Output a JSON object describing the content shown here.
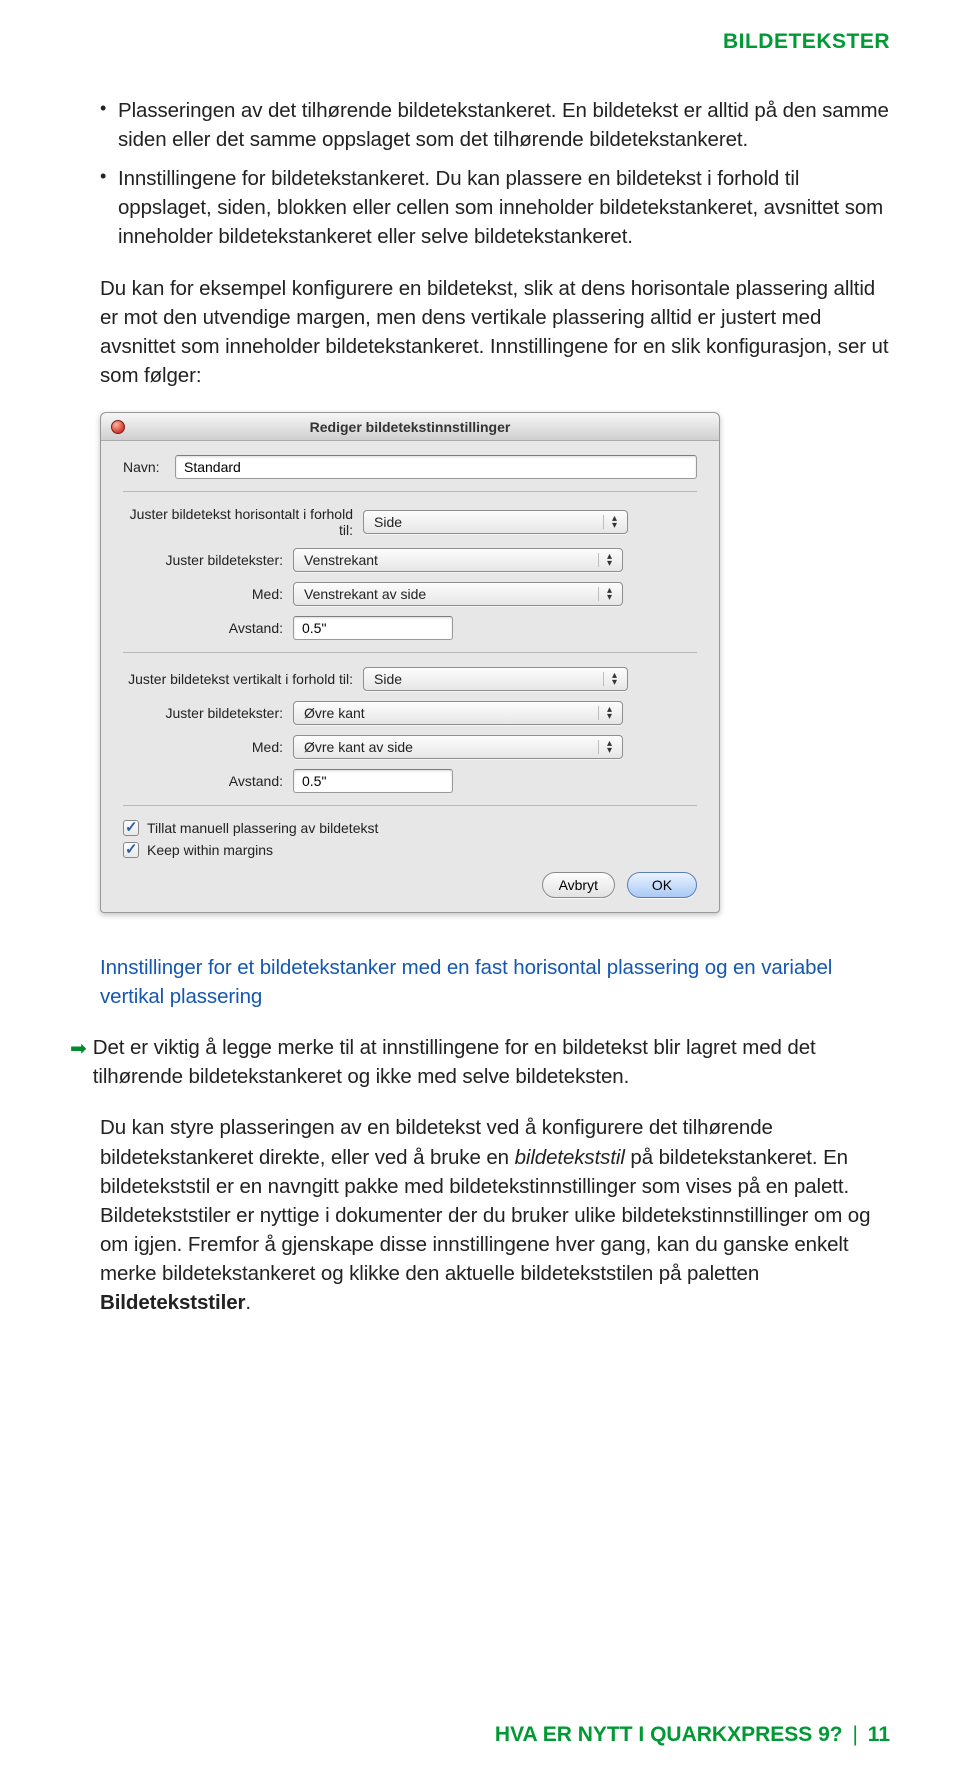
{
  "header": {
    "title": "BILDETEKSTER"
  },
  "bullets": [
    "Plasseringen av det tilhørende bildetekstankeret. En bildetekst er alltid på den samme siden eller det samme oppslaget som det tilhørende bildetekstankeret.",
    "Innstillingene for bildetekstankeret. Du kan plassere en bildetekst i forhold til oppslaget, siden, blokken eller cellen som inneholder bildetekstankeret, avsnittet som inneholder bildetekstankeret eller selve bildetekstankeret."
  ],
  "para1": "Du kan for eksempel konfigurere en bildetekst, slik at dens horisontale plassering alltid er mot den utvendige margen, men dens vertikale plassering alltid er justert med avsnittet som inneholder bildetekstankeret. Innstillingene for en slik konfigurasjon, ser ut som følger:",
  "dialog": {
    "title": "Rediger bildetekstinnstillinger",
    "name_label": "Navn:",
    "name_value": "Standard",
    "h_relative_label": "Juster bildetekst horisontalt i forhold til:",
    "h_relative_value": "Side",
    "h_align_label": "Juster bildetekster:",
    "h_align_value": "Venstrekant",
    "h_with_label": "Med:",
    "h_with_value": "Venstrekant av side",
    "h_offset_label": "Avstand:",
    "h_offset_value": "0.5\"",
    "v_relative_label": "Juster bildetekst vertikalt i forhold til:",
    "v_relative_value": "Side",
    "v_align_label": "Juster bildetekster:",
    "v_align_value": "Øvre kant",
    "v_with_label": "Med:",
    "v_with_value": "Øvre kant av side",
    "v_offset_label": "Avstand:",
    "v_offset_value": "0.5\"",
    "chk1": "Tillat manuell plassering av bildetekst",
    "chk2": "Keep within margins",
    "cancel": "Avbryt",
    "ok": "OK"
  },
  "caption": "Innstillinger for et bildetekstanker med en fast horisontal plassering og en variabel vertikal plassering",
  "note": "Det er viktig å legge merke til at innstillingene for en bildetekst blir lagret med det tilhørende bildetekstankeret og ikke med selve bildeteksten.",
  "para2_a": "Du kan styre plasseringen av en bildetekst ved å konfigurere det tilhørende bildetekstankeret direkte, eller ved å bruke en ",
  "para2_b": "bildetekststil",
  "para2_c": " på bildetekstankeret. En bildetekststil er en navngitt pakke med bildetekstinnstillinger som vises på en palett. Bildetekststiler er nyttige i dokumenter der du bruker ulike bildetekstinnstillinger om og om igjen. Fremfor å gjenskape disse innstillingene hver gang, kan du ganske enkelt merke bildetekstankeret og klikke den aktuelle bildetekststilen på paletten ",
  "para2_d": "Bildetekststiler",
  "para2_e": ".",
  "footer": {
    "text": "HVA ER NYTT I QUARKXPRESS 9?",
    "page": "11"
  }
}
